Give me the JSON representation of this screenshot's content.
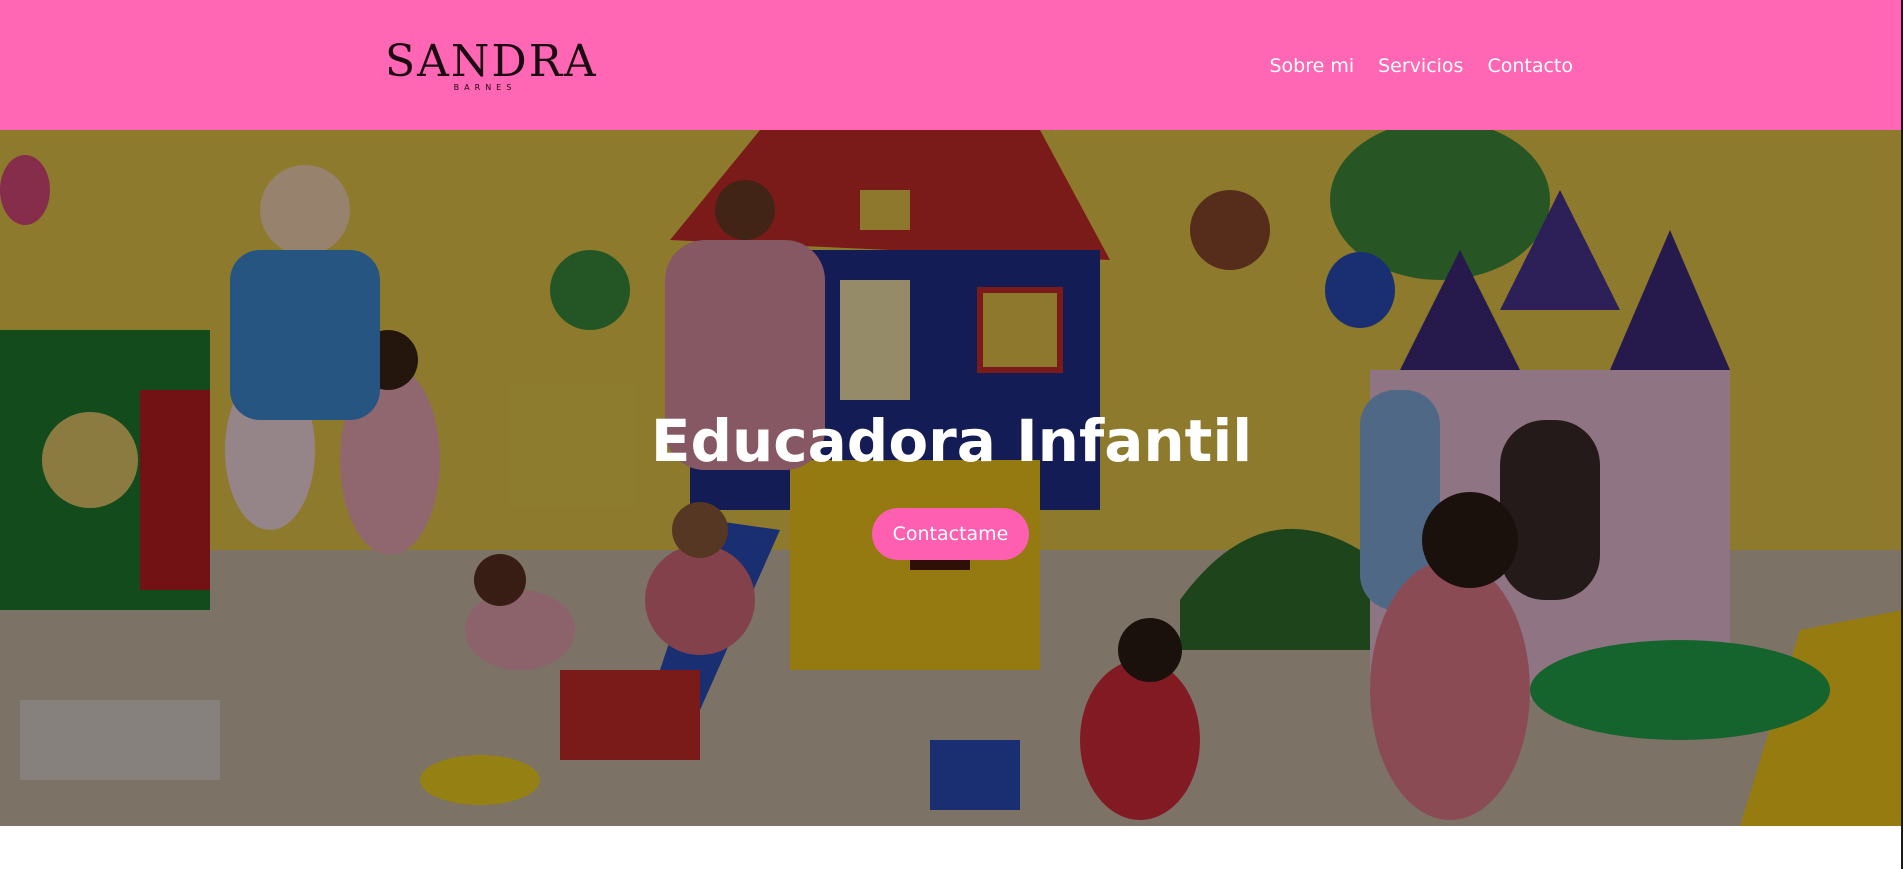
{
  "header": {
    "logo": {
      "main": "SANDRA",
      "sub": "BARNES"
    },
    "nav": [
      {
        "label": "Sobre mi"
      },
      {
        "label": "Servicios"
      },
      {
        "label": "Contacto"
      }
    ]
  },
  "hero": {
    "title": "Educadora Infantil",
    "cta_label": "Contactame",
    "background_image": "kindergarten-classroom-photo"
  },
  "colors": {
    "header_bg": "#ff66b3",
    "accent": "#ff5fb0",
    "text_on_dark": "#ffffff"
  }
}
